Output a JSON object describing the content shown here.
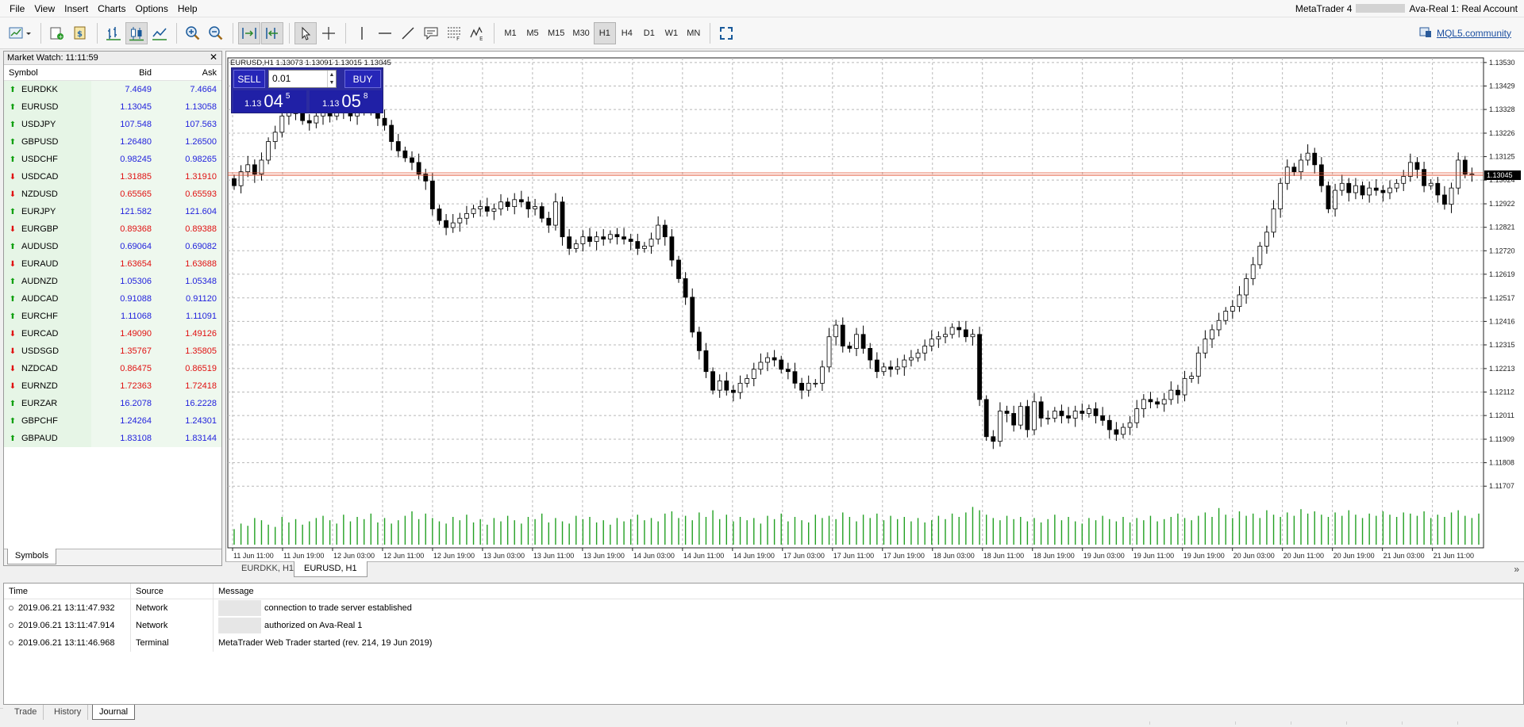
{
  "menu": {
    "items": [
      "File",
      "View",
      "Insert",
      "Charts",
      "Options",
      "Help"
    ],
    "app_name": "MetaTrader 4",
    "account": "Ava-Real 1: Real Account"
  },
  "toolbar": {
    "timeframes": [
      "M1",
      "M5",
      "M15",
      "M30",
      "H1",
      "H4",
      "D1",
      "W1",
      "MN"
    ],
    "active_timeframe": "H1",
    "community_link": "MQL5.community"
  },
  "market_watch": {
    "title": "Market Watch: 11:11:59",
    "columns": {
      "symbol": "Symbol",
      "bid": "Bid",
      "ask": "Ask"
    },
    "rows": [
      {
        "symbol": "EURDKK",
        "bid": "7.4649",
        "ask": "7.4664",
        "dir": "up"
      },
      {
        "symbol": "EURUSD",
        "bid": "1.13045",
        "ask": "1.13058",
        "dir": "up"
      },
      {
        "symbol": "USDJPY",
        "bid": "107.548",
        "ask": "107.563",
        "dir": "up"
      },
      {
        "symbol": "GBPUSD",
        "bid": "1.26480",
        "ask": "1.26500",
        "dir": "up"
      },
      {
        "symbol": "USDCHF",
        "bid": "0.98245",
        "ask": "0.98265",
        "dir": "up"
      },
      {
        "symbol": "USDCAD",
        "bid": "1.31885",
        "ask": "1.31910",
        "dir": "down"
      },
      {
        "symbol": "NZDUSD",
        "bid": "0.65565",
        "ask": "0.65593",
        "dir": "down"
      },
      {
        "symbol": "EURJPY",
        "bid": "121.582",
        "ask": "121.604",
        "dir": "up"
      },
      {
        "symbol": "EURGBP",
        "bid": "0.89368",
        "ask": "0.89388",
        "dir": "down"
      },
      {
        "symbol": "AUDUSD",
        "bid": "0.69064",
        "ask": "0.69082",
        "dir": "up"
      },
      {
        "symbol": "EURAUD",
        "bid": "1.63654",
        "ask": "1.63688",
        "dir": "down"
      },
      {
        "symbol": "AUDNZD",
        "bid": "1.05306",
        "ask": "1.05348",
        "dir": "up"
      },
      {
        "symbol": "AUDCAD",
        "bid": "0.91088",
        "ask": "0.91120",
        "dir": "up"
      },
      {
        "symbol": "EURCHF",
        "bid": "1.11068",
        "ask": "1.11091",
        "dir": "up"
      },
      {
        "symbol": "EURCAD",
        "bid": "1.49090",
        "ask": "1.49126",
        "dir": "down"
      },
      {
        "symbol": "USDSGD",
        "bid": "1.35767",
        "ask": "1.35805",
        "dir": "down"
      },
      {
        "symbol": "NZDCAD",
        "bid": "0.86475",
        "ask": "0.86519",
        "dir": "down"
      },
      {
        "symbol": "EURNZD",
        "bid": "1.72363",
        "ask": "1.72418",
        "dir": "down"
      },
      {
        "symbol": "EURZAR",
        "bid": "16.2078",
        "ask": "16.2228",
        "dir": "up"
      },
      {
        "symbol": "GBPCHF",
        "bid": "1.24264",
        "ask": "1.24301",
        "dir": "up"
      },
      {
        "symbol": "GBPAUD",
        "bid": "1.83108",
        "ask": "1.83144",
        "dir": "up"
      }
    ],
    "tab": "Symbols"
  },
  "one_click": {
    "sell_label": "SELL",
    "buy_label": "BUY",
    "lot": "0.01",
    "bid_prefix": "1.13",
    "bid_big": "04",
    "bid_sup": "5",
    "ask_prefix": "1.13",
    "ask_big": "05",
    "ask_sup": "8"
  },
  "chart_tabs": [
    "EURDKK, H1",
    "EURUSD, H1"
  ],
  "active_chart_tab": "EURUSD, H1",
  "chart_data": {
    "type": "candlestick",
    "header": "EURUSD,H1  1.13073 1.13091 1.13015 1.13045",
    "current_price_label": "1.13045",
    "current_price": 1.13045,
    "y_ticks": [
      "1.13530",
      "1.13429",
      "1.13328",
      "1.13226",
      "1.13125",
      "1.13024",
      "1.12922",
      "1.12821",
      "1.12720",
      "1.12619",
      "1.12517",
      "1.12416",
      "1.12315",
      "1.12213",
      "1.12112",
      "1.12011",
      "1.11909",
      "1.11808",
      "1.11707"
    ],
    "ylim": [
      1.1166,
      1.1355
    ],
    "x_ticks": [
      "11 Jun 11:00",
      "11 Jun 19:00",
      "12 Jun 03:00",
      "12 Jun 11:00",
      "12 Jun 19:00",
      "13 Jun 03:00",
      "13 Jun 11:00",
      "13 Jun 19:00",
      "14 Jun 03:00",
      "14 Jun 11:00",
      "14 Jun 19:00",
      "17 Jun 03:00",
      "17 Jun 11:00",
      "17 Jun 19:00",
      "18 Jun 03:00",
      "18 Jun 11:00",
      "18 Jun 19:00",
      "19 Jun 03:00",
      "19 Jun 11:00",
      "19 Jun 19:00",
      "20 Jun 03:00",
      "20 Jun 11:00",
      "20 Jun 19:00",
      "21 Jun 03:00",
      "21 Jun 11:00"
    ],
    "grid": true,
    "bull_color": "#ffffff",
    "bear_color": "#000000",
    "volume_color": "#22a022",
    "price_line_color": "#e05030",
    "close": [
      1.13,
      1.1306,
      1.1309,
      1.1305,
      1.1311,
      1.1319,
      1.1323,
      1.133,
      1.1334,
      1.1331,
      1.1328,
      1.1327,
      1.133,
      1.1332,
      1.133,
      1.1333,
      1.1332,
      1.133,
      1.1333,
      1.1334,
      1.1332,
      1.1329,
      1.1326,
      1.1319,
      1.1315,
      1.1312,
      1.131,
      1.1305,
      1.1302,
      1.129,
      1.1285,
      1.1282,
      1.1284,
      1.1286,
      1.1288,
      1.129,
      1.1291,
      1.1289,
      1.129,
      1.1293,
      1.1291,
      1.1294,
      1.1293,
      1.129,
      1.1291,
      1.1286,
      1.1283,
      1.1293,
      1.1278,
      1.1273,
      1.1275,
      1.1278,
      1.1276,
      1.1278,
      1.1277,
      1.1279,
      1.1278,
      1.1277,
      1.1276,
      1.1273,
      1.1274,
      1.1277,
      1.1283,
      1.1278,
      1.1268,
      1.126,
      1.1252,
      1.1237,
      1.1229,
      1.122,
      1.1212,
      1.1216,
      1.1212,
      1.1211,
      1.1215,
      1.1217,
      1.1221,
      1.1224,
      1.1226,
      1.1225,
      1.1221,
      1.122,
      1.1215,
      1.1212,
      1.1215,
      1.1215,
      1.1222,
      1.1235,
      1.124,
      1.1231,
      1.123,
      1.1236,
      1.123,
      1.1225,
      1.122,
      1.1222,
      1.1221,
      1.1222,
      1.1225,
      1.1226,
      1.1228,
      1.1231,
      1.1234,
      1.1235,
      1.1236,
      1.1239,
      1.1238,
      1.1235,
      1.1236,
      1.1208,
      1.1192,
      1.119,
      1.1203,
      1.1202,
      1.1197,
      1.1205,
      1.1195,
      1.1207,
      1.12,
      1.12,
      1.1203,
      1.1201,
      1.12,
      1.1203,
      1.1202,
      1.1204,
      1.1201,
      1.1199,
      1.1195,
      1.1193,
      1.1196,
      1.1198,
      1.1204,
      1.1208,
      1.1207,
      1.1206,
      1.1208,
      1.1212,
      1.121,
      1.1217,
      1.1218,
      1.1228,
      1.1234,
      1.1238,
      1.1242,
      1.1246,
      1.1248,
      1.1253,
      1.126,
      1.1266,
      1.1274,
      1.128,
      1.129,
      1.1301,
      1.1308,
      1.1306,
      1.1311,
      1.1314,
      1.1309,
      1.13,
      1.129,
      1.1298,
      1.1301,
      1.1297,
      1.13,
      1.1296,
      1.1299,
      1.1298,
      1.1297,
      1.1299,
      1.1301,
      1.1304,
      1.131,
      1.1307,
      1.13,
      1.1301,
      1.1296,
      1.1292,
      1.1299,
      1.1311,
      1.1305,
      1.1305
    ],
    "volume": [
      14,
      19,
      17,
      24,
      22,
      18,
      16,
      25,
      20,
      23,
      18,
      21,
      24,
      26,
      22,
      19,
      27,
      21,
      25,
      23,
      28,
      20,
      24,
      19,
      22,
      26,
      30,
      23,
      28,
      24,
      21,
      19,
      25,
      22,
      27,
      20,
      23,
      18,
      24,
      21,
      26,
      22,
      19,
      25,
      23,
      28,
      20,
      24,
      21,
      19,
      26,
      23,
      25,
      20,
      22,
      18,
      24,
      21,
      23,
      27,
      22,
      24,
      21,
      28,
      30,
      24,
      26,
      22,
      29,
      25,
      31,
      23,
      27,
      21,
      25,
      22,
      24,
      19,
      26,
      23,
      28,
      21,
      25,
      22,
      20,
      27,
      24,
      26,
      23,
      29,
      25,
      21,
      27,
      24,
      28,
      22,
      26,
      23,
      25,
      21,
      24,
      20,
      22,
      26,
      23,
      28,
      25,
      29,
      34,
      31,
      27,
      24,
      22,
      26,
      23,
      25,
      21,
      24,
      20,
      23,
      27,
      22,
      25,
      21,
      19,
      24,
      22,
      26,
      23,
      21,
      25,
      20,
      24,
      22,
      26,
      21,
      23,
      25,
      28,
      24,
      22,
      26,
      29,
      25,
      33,
      27,
      24,
      30,
      26,
      28,
      24,
      31,
      27,
      25,
      29,
      26,
      32,
      28,
      30,
      27,
      25,
      29,
      26,
      31,
      27,
      24,
      28,
      26,
      30,
      27,
      25,
      29,
      28,
      26,
      30,
      24,
      27,
      25,
      29,
      31,
      26,
      24,
      28
    ]
  },
  "journal": {
    "columns": {
      "time": "Time",
      "source": "Source",
      "message": "Message"
    },
    "rows": [
      {
        "time": "2019.06.21 13:11:47.932",
        "source": "Network",
        "message": "connection to trade server established"
      },
      {
        "time": "2019.06.21 13:11:47.914",
        "source": "Network",
        "message": "authorized on Ava-Real 1"
      },
      {
        "time": "2019.06.21 13:11:46.968",
        "source": "Terminal",
        "message": "MetaTrader Web Trader started (rev. 214, 19 Jun 2019)"
      }
    ]
  },
  "terminal_tabs": [
    "Trade",
    "History",
    "Journal"
  ],
  "active_terminal_tab": "Journal"
}
